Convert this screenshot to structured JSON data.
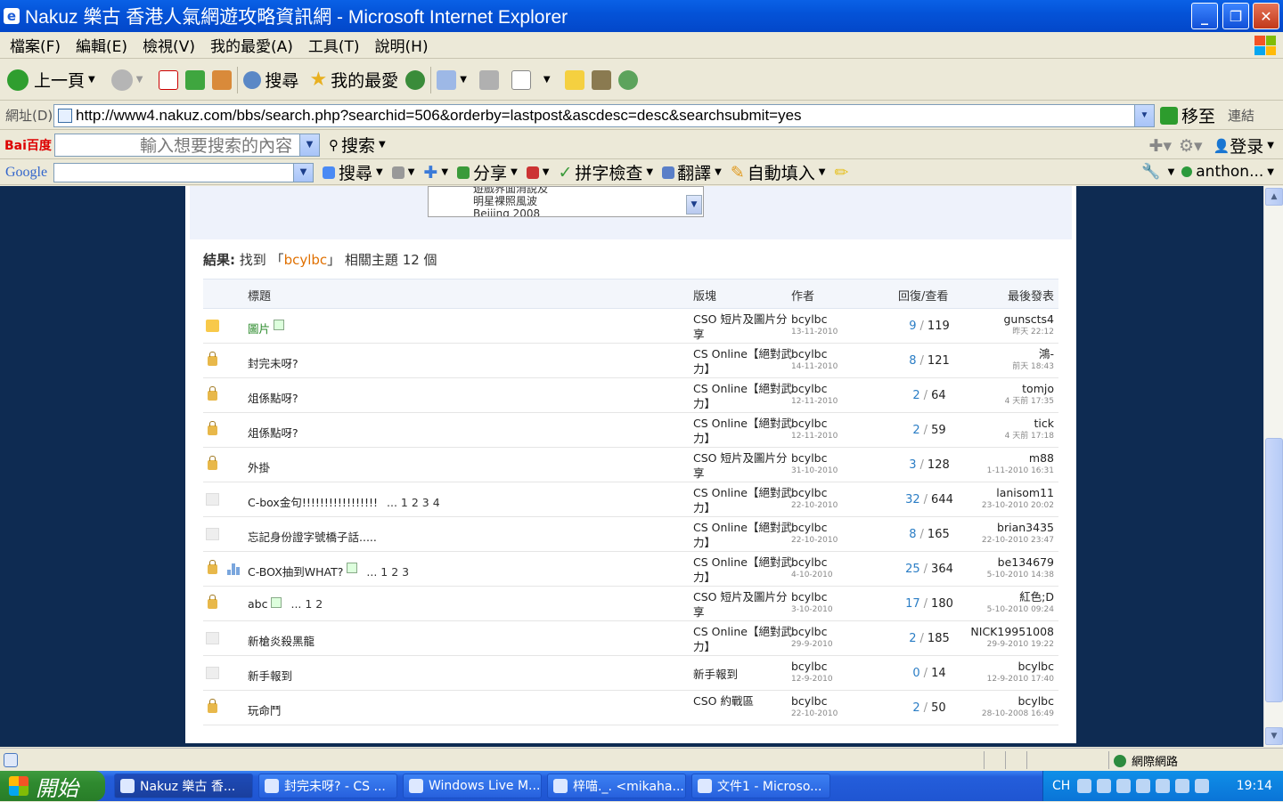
{
  "window": {
    "title": "Nakuz 樂古 香港人氣網遊攻略資訊網 - Microsoft Internet Explorer"
  },
  "menu": [
    "檔案(F)",
    "編輯(E)",
    "檢視(V)",
    "我的最愛(A)",
    "工具(T)",
    "說明(H)"
  ],
  "toolbar": {
    "back": "上一頁",
    "search": "搜尋",
    "favorites": "我的最愛"
  },
  "address": {
    "label": "網址(D)",
    "url": "http://www4.nakuz.com/bbs/search.php?searchid=506&orderby=lastpost&ascdesc=desc&searchsubmit=yes",
    "go": "移至",
    "links": "連結"
  },
  "baidu": {
    "logo": "Bai百度",
    "placeholder": "輸入想要搜索的內容",
    "search": "搜索",
    "login": "登录"
  },
  "google": {
    "logo": "Google",
    "search": "搜尋",
    "share": "分享",
    "spell": "拼字檢查",
    "translate": "翻譯",
    "autofill": "自動填入",
    "account": "anthon..."
  },
  "select_box": {
    "options": [
      "遊戲界面消說及",
      "明星裸照風波",
      "Beijing 2008"
    ]
  },
  "result": {
    "label": "結果:",
    "text1": "找到 「",
    "keyword": "bcylbc",
    "text2": "」 相關主題 12 個"
  },
  "table": {
    "headers": {
      "title": "標題",
      "forum": "版塊",
      "author": "作者",
      "replies": "回復/查看",
      "lastpost": "最後發表"
    },
    "rows": [
      {
        "icon": "folder",
        "title": "圖片",
        "green": true,
        "img": true,
        "pages": "",
        "forum": "CSO 短片及圖片分享",
        "author": "bcylbc",
        "date": "13-11-2010",
        "replies": "9",
        "views": "119",
        "last_user": "gunscts4",
        "last_time": "昨天 22:12"
      },
      {
        "icon": "lock",
        "title": "封完未呀?",
        "green": false,
        "img": false,
        "pages": "",
        "forum": "CS Online【絕對武力】",
        "author": "bcylbc",
        "date": "14-11-2010",
        "replies": "8",
        "views": "121",
        "last_user": "鴻-",
        "last_time": "前天 18:43"
      },
      {
        "icon": "lock",
        "title": "俎係點呀?",
        "green": false,
        "img": false,
        "pages": "",
        "forum": "CS Online【絕對武力】",
        "author": "bcylbc",
        "date": "12-11-2010",
        "replies": "2",
        "views": "64",
        "last_user": "tomjo",
        "last_time": "4 天前 17:35"
      },
      {
        "icon": "lock",
        "title": "俎係點呀?",
        "green": false,
        "img": false,
        "pages": "",
        "forum": "CS Online【絕對武力】",
        "author": "bcylbc",
        "date": "12-11-2010",
        "replies": "2",
        "views": "59",
        "last_user": "tick",
        "last_time": "4 天前 17:18"
      },
      {
        "icon": "lock",
        "title": "外掛",
        "green": false,
        "img": false,
        "pages": "",
        "forum": "CSO 短片及圖片分享",
        "author": "bcylbc",
        "date": "31-10-2010",
        "replies": "3",
        "views": "128",
        "last_user": "m88",
        "last_time": "1-11-2010 16:31"
      },
      {
        "icon": "blank",
        "title": "C-box金句!!!!!!!!!!!!!!!!!",
        "green": false,
        "img": false,
        "pages": "... 1 2 3 4",
        "forum": "CS Online【絕對武力】",
        "author": "bcylbc",
        "date": "22-10-2010",
        "replies": "32",
        "views": "644",
        "last_user": "lanisom11",
        "last_time": "23-10-2010 20:02"
      },
      {
        "icon": "blank",
        "title": "忘記身份證字號橋子話.....",
        "green": false,
        "img": false,
        "pages": "",
        "forum": "CS Online【絕對武力】",
        "author": "bcylbc",
        "date": "22-10-2010",
        "replies": "8",
        "views": "165",
        "last_user": "brian3435",
        "last_time": "22-10-2010 23:47"
      },
      {
        "icon": "lock",
        "poll": true,
        "title": "C-BOX抽到WHAT?",
        "green": false,
        "img": true,
        "pages": "... 1 2 3",
        "forum": "CS Online【絕對武力】",
        "author": "bcylbc",
        "date": "4-10-2010",
        "replies": "25",
        "views": "364",
        "last_user": "be134679",
        "last_time": "5-10-2010 14:38"
      },
      {
        "icon": "lock",
        "title": "abc",
        "green": false,
        "img": true,
        "pages": "... 1 2",
        "forum": "CSO 短片及圖片分享",
        "author": "bcylbc",
        "date": "3-10-2010",
        "replies": "17",
        "views": "180",
        "last_user": "紅色;D",
        "last_time": "5-10-2010 09:24"
      },
      {
        "icon": "blank",
        "title": "新槍炎殺黑龍",
        "green": false,
        "img": false,
        "pages": "",
        "forum": "CS Online【絕對武力】",
        "author": "bcylbc",
        "date": "29-9-2010",
        "replies": "2",
        "views": "185",
        "last_user": "NICK19951008",
        "last_time": "29-9-2010 19:22"
      },
      {
        "icon": "blank",
        "title": "新手報到",
        "green": false,
        "img": false,
        "pages": "",
        "forum": "新手報到",
        "author": "bcylbc",
        "date": "12-9-2010",
        "replies": "0",
        "views": "14",
        "last_user": "bcylbc",
        "last_time": "12-9-2010 17:40"
      },
      {
        "icon": "lock",
        "title": "玩命鬥",
        "green": false,
        "img": false,
        "pages": "",
        "forum": "CSO 約戰區",
        "author": "bcylbc",
        "date": "22-10-2010",
        "replies": "2",
        "views": "50",
        "last_user": "bcylbc",
        "last_time": "28-10-2008 16:49"
      }
    ]
  },
  "status": {
    "zone": "網際網路"
  },
  "taskbar": {
    "start": "開始",
    "tasks": [
      "Nakuz 樂古 香...",
      "封完未呀? - CS ...",
      "Windows Live M...",
      "梓喵._. <mikaha...",
      "文件1 - Microso..."
    ],
    "lang": "CH",
    "clock": "19:14"
  },
  "colors": {
    "titlebar": "#0453d8",
    "page_bg": "#0e2b52",
    "reply_count": "#2a7dc5",
    "keyword": "#e07000"
  }
}
